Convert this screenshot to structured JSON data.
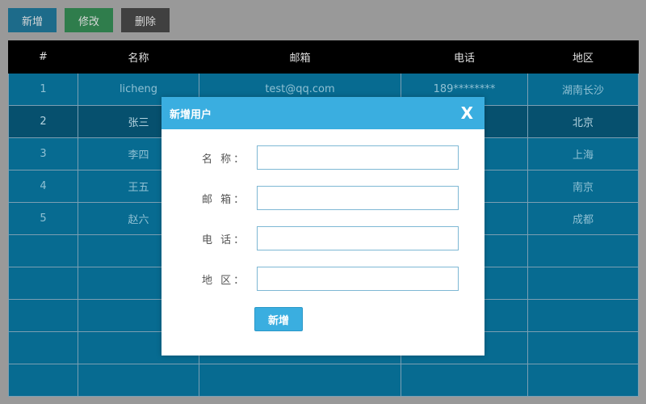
{
  "toolbar": {
    "add_label": "新增",
    "edit_label": "修改",
    "delete_label": "删除"
  },
  "table": {
    "headers": [
      "#",
      "名称",
      "邮箱",
      "电话",
      "地区"
    ],
    "rows": [
      [
        "1",
        "licheng",
        "test@qq.com",
        "189********",
        "湖南长沙"
      ],
      [
        "2",
        "张三",
        "",
        "**",
        "北京"
      ],
      [
        "3",
        "李四",
        "",
        "**",
        "上海"
      ],
      [
        "4",
        "王五",
        "",
        "**",
        "南京"
      ],
      [
        "5",
        "赵六",
        "",
        "**",
        "成都"
      ]
    ],
    "empty_rows": 5
  },
  "modal": {
    "title": "新增用户",
    "close_label": "X",
    "fields": [
      {
        "label": "名 称：",
        "value": ""
      },
      {
        "label": "邮 箱：",
        "value": ""
      },
      {
        "label": "电 话：",
        "value": ""
      },
      {
        "label": "地 区：",
        "value": ""
      }
    ],
    "submit_label": "新增"
  },
  "colors": {
    "background": "#999999",
    "table_header": "#000000",
    "table_row": "#076b91",
    "table_row_active": "#06506e",
    "modal_header": "#3aaee0",
    "btn_add": "#1d6b8a",
    "btn_edit": "#2f7d4c",
    "btn_delete": "#404040"
  }
}
